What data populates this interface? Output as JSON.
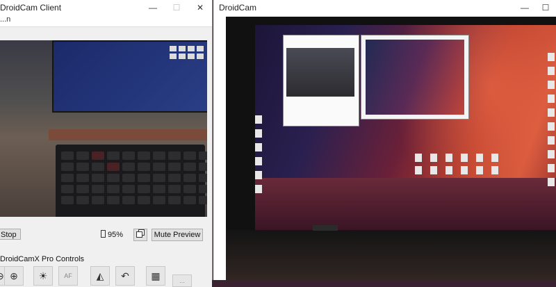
{
  "left_window": {
    "title": "DroidCam Client",
    "minimize": "—",
    "maximize": "☐",
    "close": "✕",
    "menu": "...n",
    "stop_button": "Stop",
    "battery": "95%",
    "copy_button_icon": "copy-icon",
    "mute_preview_button": "Mute Preview",
    "pro_controls_label": "DroidCamX Pro Controls",
    "pro_buttons": [
      {
        "icon": "zoom-out-icon",
        "glyph": "⊖"
      },
      {
        "icon": "zoom-in-icon",
        "glyph": "⊕"
      },
      {
        "icon": "brightness-icon",
        "glyph": "☀"
      },
      {
        "icon": "autofocus-icon",
        "glyph": "AF"
      },
      {
        "icon": "mirror-icon",
        "glyph": "◭"
      },
      {
        "icon": "rotate-icon",
        "glyph": "↶"
      },
      {
        "icon": "resolution-icon",
        "glyph": "▦"
      },
      {
        "icon": "more-icon",
        "glyph": "..."
      }
    ]
  },
  "right_window": {
    "title": "DroidCam",
    "minimize": "—",
    "maximize": "☐"
  },
  "colors": {
    "window_bg": "#f0f0f0",
    "titlebar_bg": "#ffffff",
    "button_bg": "#e1e1e1"
  }
}
